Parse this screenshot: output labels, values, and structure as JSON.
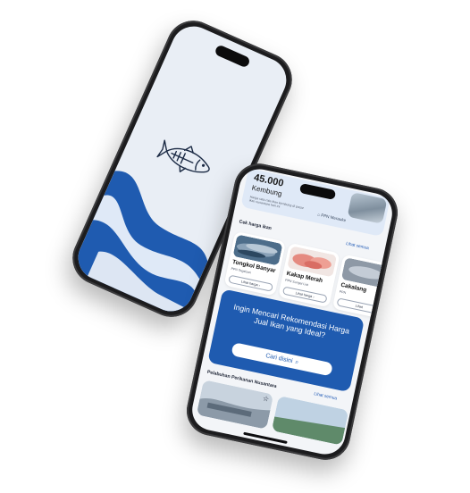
{
  "splash": {
    "logo_icon": "tuna-fish-icon",
    "colors": {
      "background": "#e9eef5",
      "wave_primary": "#1f5bb0",
      "wave_light": "#dfe9f7"
    }
  },
  "app": {
    "top_card": {
      "price": "45.000",
      "name": "Kembung",
      "note": "Harga rata-rata ikan kembung di pasar ikan nusantara hari ini",
      "location": "PPN Merauke"
    },
    "fish_section": {
      "title": "Cek harga ikan",
      "see_all": "Lihat semua",
      "cards": [
        {
          "name": "Tongkol Banyar",
          "location": "PPN Tegalsari",
          "button": "Lihat harga ›"
        },
        {
          "name": "Kakap Merah",
          "location": "PPN Sungai Liat",
          "button": "Lihat harga ›"
        },
        {
          "name": "Cakalang",
          "location": "PPN",
          "button": "Lihat"
        }
      ]
    },
    "promo": {
      "text": "Ingin Mencari Rekomendasi Harga Jual Ikan yang Ideal?",
      "button": "Cari disini"
    },
    "port_section": {
      "title": "Pelabuhan Perikanan Nusantara",
      "see_all": "Lihat semua"
    },
    "colors": {
      "primary": "#1f5bb0",
      "surface": "#f3f5f8",
      "card": "#ffffff"
    }
  }
}
